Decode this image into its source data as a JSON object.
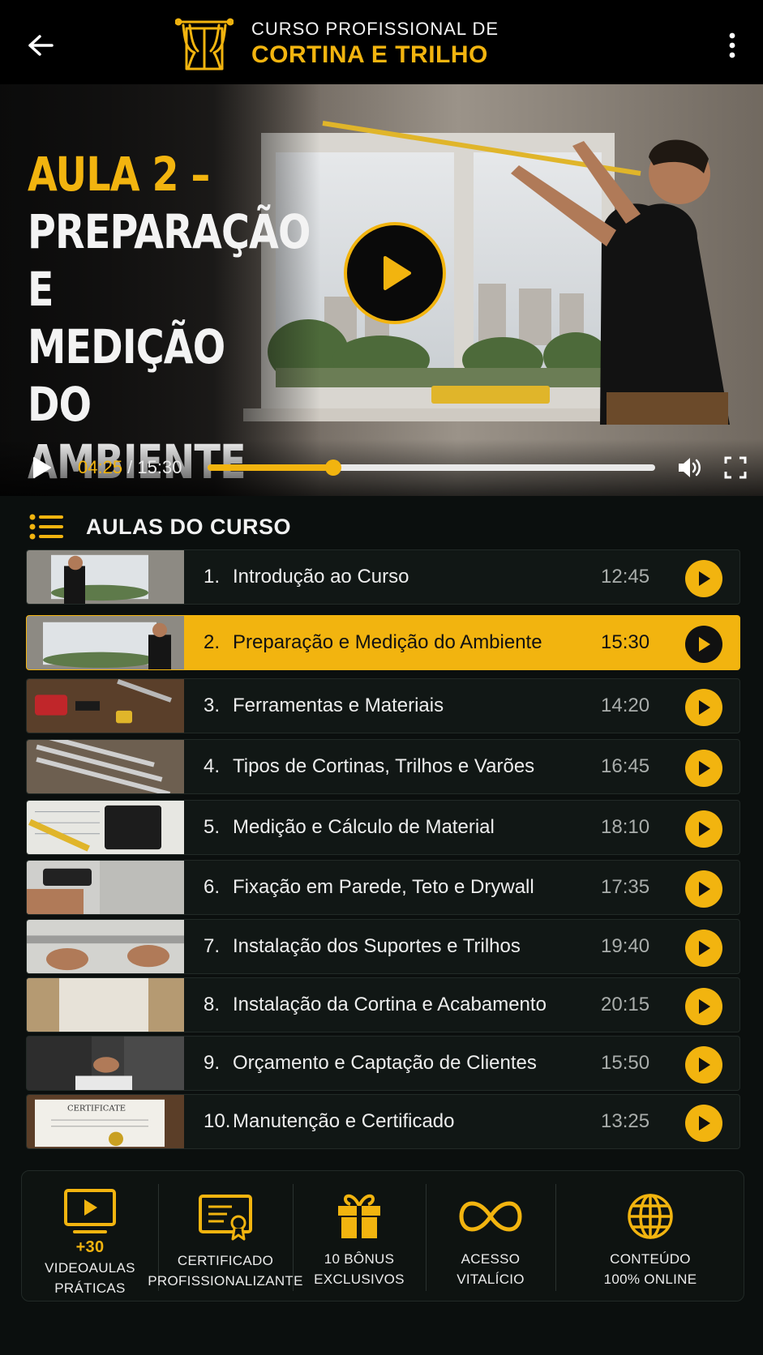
{
  "header": {
    "line1": "CURSO PROFISSIONAL DE",
    "line2": "CORTINA E TRILHO",
    "back_icon": "arrow-left-icon",
    "menu_icon": "more-vertical-icon",
    "logo_icon": "curtain-icon"
  },
  "video": {
    "title_accent": "AULA 2 –",
    "title_main": "PREPARAÇÃO\nE MEDIÇÃO\nDO AMBIENTE",
    "current_time": "04:25",
    "separator": " / ",
    "total_time": "15:30",
    "progress_fraction": 0.28
  },
  "lessons": {
    "title": "AULAS DO CURSO",
    "items": [
      {
        "num": "1.",
        "name": "Introdução ao Curso",
        "duration": "12:45",
        "active": false
      },
      {
        "num": "2.",
        "name": "Preparação e Medição do Ambiente",
        "duration": "15:30",
        "active": true
      },
      {
        "num": "3.",
        "name": "Ferramentas e Materiais",
        "duration": "14:20",
        "active": false
      },
      {
        "num": "4.",
        "name": "Tipos de Cortinas, Trilhos e Varões",
        "duration": "16:45",
        "active": false
      },
      {
        "num": "5.",
        "name": "Medição e Cálculo de Material",
        "duration": "18:10",
        "active": false
      },
      {
        "num": "6.",
        "name": "Fixação em Parede, Teto e Drywall",
        "duration": "17:35",
        "active": false
      },
      {
        "num": "7.",
        "name": "Instalação dos Suportes e Trilhos",
        "duration": "19:40",
        "active": false
      },
      {
        "num": "8.",
        "name": "Instalação da Cortina e Acabamento",
        "duration": "20:15",
        "active": false
      },
      {
        "num": "9.",
        "name": "Orçamento e Captação de Clientes",
        "duration": "15:50",
        "active": false
      },
      {
        "num": "10.",
        "name": "Manutenção e Certificado",
        "duration": "13:25",
        "active": false
      }
    ]
  },
  "features": [
    {
      "icon": "video-monitor-icon",
      "highlight": "+30",
      "line1": "VIDEOAULAS",
      "line2": "PRÁTICAS"
    },
    {
      "icon": "certificate-icon",
      "highlight": "",
      "line1": "CERTIFICADO",
      "line2": "PROFISSIONALIZANTE"
    },
    {
      "icon": "gift-icon",
      "highlight": "",
      "line1": "10 BÔNUS",
      "line2": "EXCLUSIVOS"
    },
    {
      "icon": "infinity-icon",
      "highlight": "",
      "line1": "ACESSO",
      "line2": "VITALÍCIO"
    },
    {
      "icon": "globe-icon",
      "highlight": "",
      "line1": "CONTEÚDO",
      "line2": "100% ONLINE"
    }
  ],
  "colors": {
    "accent": "#f2b40f",
    "background": "#0b0f0e",
    "header": "#000000"
  }
}
